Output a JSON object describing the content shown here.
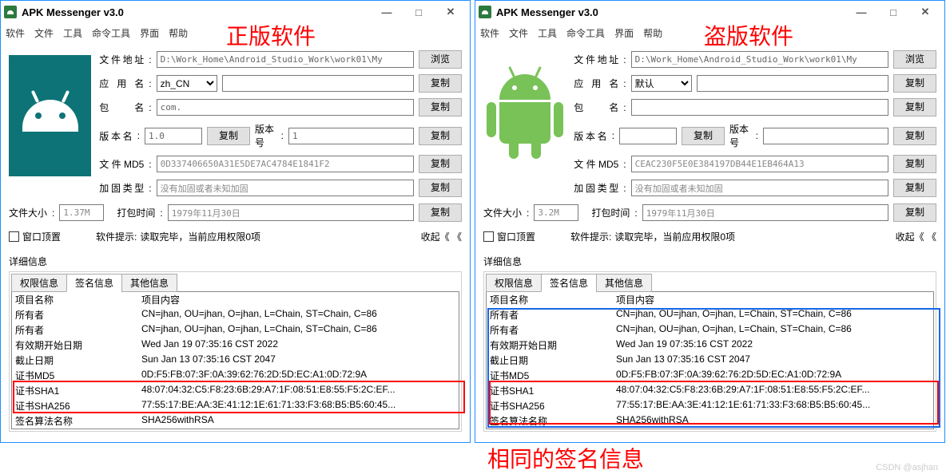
{
  "annotations": {
    "left_title": "正版软件",
    "right_title": "盗版软件",
    "bottom": "相同的签名信息",
    "watermark": "CSDN @asjhan"
  },
  "left": {
    "title": "APK Messenger v3.0",
    "menu": [
      "软件",
      "文件",
      "工具",
      "命令工具",
      "界面",
      "帮助"
    ],
    "fields": {
      "path_label": "文件地址",
      "path_value": "D:\\Work_Home\\Android_Studio_Work\\work01\\My",
      "browse": "浏览",
      "appname_label": "应用名",
      "appname_value": "zh_CN",
      "appname_text": "",
      "pkg_label": "包名",
      "pkg_value": "com.",
      "ver_label": "版本名",
      "ver_value": "1.0",
      "vercode_label": "版本号",
      "vercode_value": "1",
      "md5_label": "文件MD5",
      "md5_value": "0D337406650A31E5DE7AC4784E1841F2",
      "harden_label": "加固类型",
      "harden_value": "没有加固或者未知加固",
      "copy": "复制",
      "filesize_label": "文件大小",
      "filesize_value": "1.37M",
      "packtime_label": "打包时间",
      "packtime_value": "1979年11月30日",
      "pin_label": "窗口顶置",
      "tip_label": "软件提示:",
      "tip_value": "读取完毕，当前应用权限0项",
      "collapse": "收起《 《"
    },
    "details_label": "详细信息",
    "tabs": [
      "权限信息",
      "签名信息",
      "其他信息"
    ],
    "table": {
      "h1": "项目名称",
      "h2": "项目内容",
      "rows": [
        [
          "所有者",
          "CN=jhan, OU=jhan, O=jhan, L=Chain, ST=Chain, C=86"
        ],
        [
          "所有者",
          "CN=jhan, OU=jhan, O=jhan, L=Chain, ST=Chain, C=86"
        ],
        [
          "有效期开始日期",
          "Wed Jan 19 07:35:16 CST 2022"
        ],
        [
          "截止日期",
          "Sun Jan 13 07:35:16 CST 2047"
        ],
        [
          "证书MD5",
          "0D:F5:FB:07:3F:0A:39:62:76:2D:5D:EC:A1:0D:72:9A"
        ],
        [
          "证书SHA1",
          "48:07:04:32:C5:F8:23:6B:29:A7:1F:08:51:E8:55:F5:2C:EF..."
        ],
        [
          "证书SHA256",
          "77:55:17:BE:AA:3E:41:12:1E:61:71:33:F3:68:B5:B5:60:45..."
        ],
        [
          "签名算法名称",
          "SHA256withRSA"
        ]
      ]
    }
  },
  "right": {
    "title": "APK Messenger v3.0",
    "menu": [
      "软件",
      "文件",
      "工具",
      "命令工具",
      "界面",
      "帮助"
    ],
    "fields": {
      "path_label": "文件地址",
      "path_value": "D:\\Work_Home\\Android_Studio_Work\\work01\\My",
      "browse": "浏览",
      "appname_label": "应用名",
      "appname_value": "默认",
      "appname_text": "",
      "pkg_label": "包名",
      "pkg_value": "",
      "ver_label": "版本名",
      "ver_value": "",
      "vercode_label": "版本号",
      "vercode_value": "",
      "md5_label": "文件MD5",
      "md5_value": "CEAC230F5E0E384197DB44E1EB464A13",
      "harden_label": "加固类型",
      "harden_value": "没有加固或者未知加固",
      "copy": "复制",
      "filesize_label": "文件大小",
      "filesize_value": "3.2M",
      "packtime_label": "打包时间",
      "packtime_value": "1979年11月30日",
      "pin_label": "窗口顶置",
      "tip_label": "软件提示:",
      "tip_value": "读取完毕，当前应用权限0项",
      "collapse": "收起《 《"
    },
    "details_label": "详细信息",
    "tabs": [
      "权限信息",
      "签名信息",
      "其他信息"
    ],
    "table": {
      "h1": "项目名称",
      "h2": "项目内容",
      "rows": [
        [
          "所有者",
          "CN=jhan, OU=jhan, O=jhan, L=Chain, ST=Chain, C=86"
        ],
        [
          "所有者",
          "CN=jhan, OU=jhan, O=jhan, L=Chain, ST=Chain, C=86"
        ],
        [
          "有效期开始日期",
          "Wed Jan 19 07:35:16 CST 2022"
        ],
        [
          "截止日期",
          "Sun Jan 13 07:35:16 CST 2047"
        ],
        [
          "证书MD5",
          "0D:F5:FB:07:3F:0A:39:62:76:2D:5D:EC:A1:0D:72:9A"
        ],
        [
          "证书SHA1",
          "48:07:04:32:C5:F8:23:6B:29:A7:1F:08:51:E8:55:F5:2C:EF..."
        ],
        [
          "证书SHA256",
          "77:55:17:BE:AA:3E:41:12:1E:61:71:33:F3:68:B5:B5:60:45..."
        ],
        [
          "签名算法名称",
          "SHA256withRSA"
        ]
      ]
    }
  }
}
